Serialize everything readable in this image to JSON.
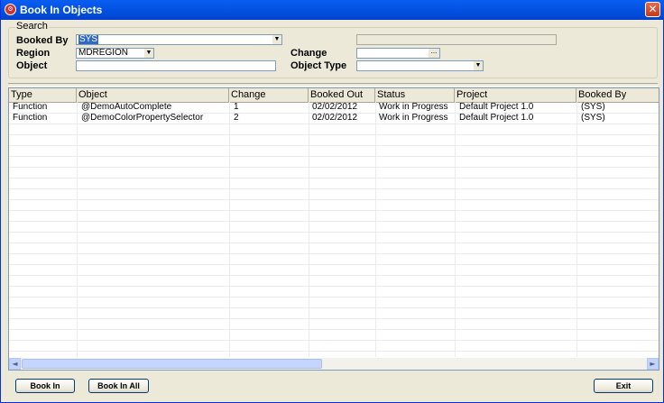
{
  "window": {
    "title": "Book In Objects",
    "icon": "app-logo-icon",
    "close_label": "✕"
  },
  "search": {
    "group_label": "Search",
    "booked_by": {
      "label": "Booked By",
      "value": "SYS"
    },
    "region": {
      "label": "Region",
      "value": "MDREGION"
    },
    "object": {
      "label": "Object",
      "value": ""
    },
    "change": {
      "label": "Change",
      "value": "",
      "button": "..."
    },
    "object_type": {
      "label": "Object Type",
      "value": ""
    },
    "readonly_field": ""
  },
  "grid": {
    "columns": [
      "Type",
      "Object",
      "Change",
      "Booked Out",
      "Status",
      "Project",
      "Booked By"
    ],
    "rows": [
      [
        "Function",
        "@DemoAutoComplete",
        "1",
        "02/02/2012",
        "Work in Progress",
        "Default Project 1.0",
        "(SYS)"
      ],
      [
        "Function",
        "@DemoColorPropertySelector",
        "2",
        "02/02/2012",
        "Work in Progress",
        "Default Project 1.0",
        "(SYS)"
      ]
    ],
    "scroll_left": "◄",
    "scroll_right": "►"
  },
  "buttons": {
    "book_in": "Book In",
    "book_in_all": "Book In All",
    "exit": "Exit"
  },
  "colors": {
    "titlebar": "#0454e5",
    "selection": "#316ac5",
    "close": "#c43a1a"
  }
}
